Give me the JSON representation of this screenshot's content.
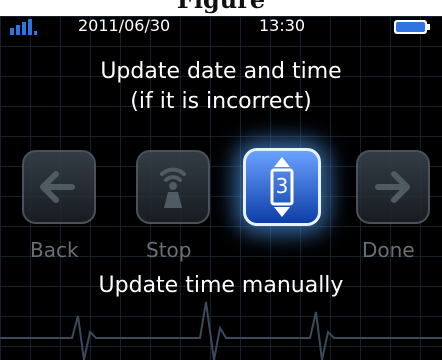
{
  "header_peek": "Figure",
  "status_bar": {
    "date": "2011/06/30",
    "time": "13:30",
    "signal_icon": "signal-bars-icon",
    "battery_icon": "battery-full-icon"
  },
  "title": {
    "line1": "Update date and time",
    "line2": "(if it is incorrect)"
  },
  "buttons": {
    "back": {
      "label": "Back",
      "icon": "arrow-left-icon",
      "state": "disabled"
    },
    "stop": {
      "label": "Stop",
      "icon": "wireless-transmit-icon",
      "state": "disabled"
    },
    "adjust": {
      "value": "3",
      "icon": "up-down-stepper-icon",
      "state": "selected"
    },
    "done": {
      "label": "Done",
      "icon": "arrow-right-icon",
      "state": "disabled"
    }
  },
  "hint": "Update time manually",
  "colors": {
    "background": "#000000",
    "grid": "#1c2a3a",
    "selected_accent": "#2f74e0",
    "disabled_text": "#6a6f75"
  }
}
